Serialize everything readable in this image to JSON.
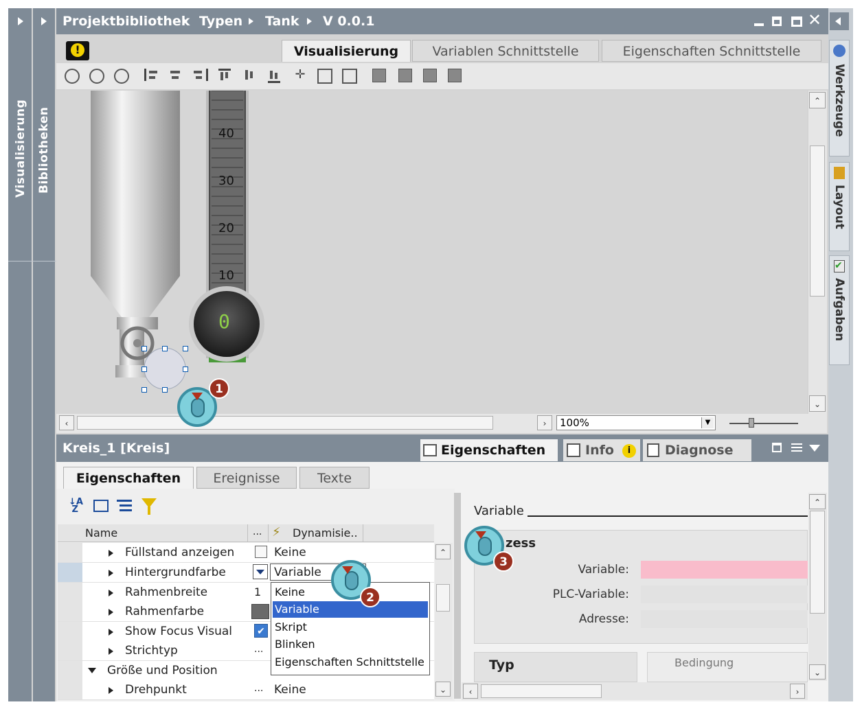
{
  "window": {
    "breadcrumb": [
      "Projektbibliothek",
      "Typen",
      "Tank",
      "V 0.0.1"
    ],
    "controls": [
      "minimize",
      "restore",
      "maximize",
      "close"
    ]
  },
  "left_sidebar": {
    "tabs": [
      "Visualisierung",
      "Bibliotheken"
    ]
  },
  "right_sidebar": {
    "tabs": [
      "Werkzeuge",
      "Layout",
      "Aufgaben"
    ]
  },
  "editor": {
    "tabs": [
      "Visualisierung",
      "Variablen Schnittstelle",
      "Eigenschaften Schnittstelle"
    ],
    "active_tab": "Visualisierung",
    "scale_labels": [
      "40",
      "30",
      "20",
      "10"
    ],
    "display_value": "0",
    "zoom": "100%"
  },
  "inspector": {
    "object_title": "Kreis_1 [Kreis]",
    "header_tabs": [
      "Eigenschaften",
      "Info",
      "Diagnose"
    ],
    "sub_tabs": [
      "Eigenschaften",
      "Ereignisse",
      "Texte"
    ],
    "table_headers": {
      "name": "Name",
      "dots": "...",
      "dyn": "Dynamisie.."
    },
    "rows": [
      {
        "name": "Füllstand anzeigen",
        "static": "",
        "dyn": "Keine"
      },
      {
        "name": "Hintergrundfarbe",
        "static": "",
        "dyn": "Variable"
      },
      {
        "name": "Rahmenbreite",
        "static": "1",
        "dyn": ""
      },
      {
        "name": "Rahmenfarbe",
        "static": "",
        "dyn": ""
      },
      {
        "name": "Show Focus Visual",
        "static": "",
        "dyn": ""
      },
      {
        "name": "Strichtyp",
        "static": "...",
        "dyn": ""
      },
      {
        "name": "Größe und Position",
        "static": "",
        "dyn": ""
      },
      {
        "name": "Drehpunkt",
        "static": "...",
        "dyn": "Keine"
      }
    ],
    "dropdown_options": [
      "Keine",
      "Variable",
      "Skript",
      "Blinken",
      "Eigenschaften Schnittstelle"
    ],
    "dropdown_selected": "Variable"
  },
  "detail": {
    "heading": "Variable",
    "group": "zess",
    "labels": [
      "Variable:",
      "PLC-Variable:",
      "Adresse:"
    ],
    "typ_label": "Typ",
    "bedingung_label": "Bedingung"
  },
  "callouts": [
    "1",
    "2",
    "3"
  ],
  "colors": {
    "bar": "#7f8b97",
    "highlight_field": "#f9bccb",
    "selection": "#3366cc",
    "badge": "#9a3020"
  }
}
